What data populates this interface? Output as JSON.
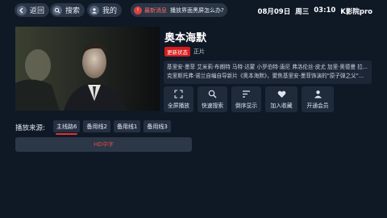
{
  "topbar": {
    "back_label": "返回",
    "search_label": "搜索",
    "mine_label": "我的",
    "notice_label": "最新消息",
    "notice_text": "播放界面黑屏怎么办?",
    "date": "08月09日",
    "weekday": "周三",
    "time": "03:10",
    "brand": "K影院pro"
  },
  "movie": {
    "title": "奥本海默",
    "status_tag": "更新状态",
    "quality": "正片",
    "description_line1": "基里安·墨菲 艾米莉·布朗特 马特·达蒙 小罗伯特·唐尼 弗洛伦丝·皮尤 加里·奥德曼 拉...",
    "description_line2": "克里斯托弗·诺兰自编自导新片《奥本海默》，聚焦基里安·墨菲饰演的\"原子弹之父\"..."
  },
  "actions": [
    {
      "label": "全屏播放",
      "icon": "fullscreen-icon"
    },
    {
      "label": "快速搜索",
      "icon": "search-icon"
    },
    {
      "label": "倒序显示",
      "icon": "sort-icon"
    },
    {
      "label": "加入收藏",
      "icon": "heart-icon"
    },
    {
      "label": "开通会员",
      "icon": "user-icon"
    }
  ],
  "source": {
    "label": "播放来源:",
    "tabs": [
      {
        "label": "主线路6",
        "active": true
      },
      {
        "label": "备用线2",
        "active": false
      },
      {
        "label": "备用线1",
        "active": false
      },
      {
        "label": "备用线3",
        "active": false
      }
    ]
  },
  "episodes": [
    {
      "label": "HD中字"
    }
  ],
  "colors": {
    "background": "#0f1825",
    "accent_red": "#d61c1c",
    "card": "#1f2a3b"
  }
}
